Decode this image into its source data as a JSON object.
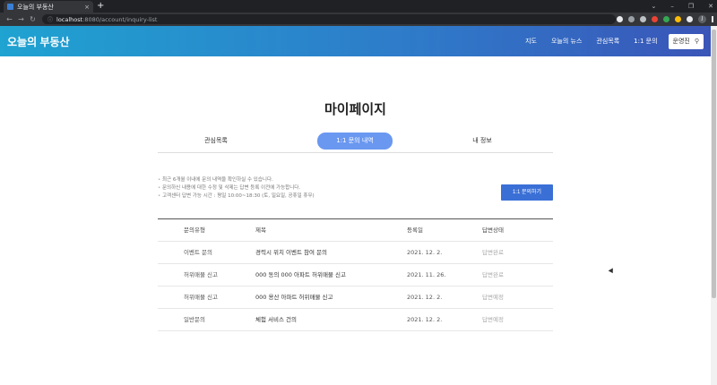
{
  "browser": {
    "tab_title": "오늘의 부동산",
    "tab_close": "×",
    "new_tab": "+",
    "url_host": "localhost",
    "url_path": ":8080/account/inquiry-list",
    "profile_initial": "J",
    "window_controls": [
      "⌄",
      "–",
      "❐",
      "✕"
    ]
  },
  "header": {
    "logo": "오늘의 부동산",
    "nav": [
      "지도",
      "오늘의 뉴스",
      "관심목록",
      "1:1 문의"
    ],
    "user_name": "운영진"
  },
  "page": {
    "title": "마이페이지",
    "tabs": [
      "관심목록",
      "1:1 문의 내역",
      "내 정보"
    ],
    "active_tab": "1:1 문의 내역"
  },
  "notice": [
    "최근 6개월 이내에 문의 내역을 확인하실 수 있습니다.",
    "문의하신 내용에 대한 수정 및 삭제는 답변 등록 이전에 가능합니다.",
    "고객센터 답변 가능 시간 : 평일 10:00~18:30 (토, 일요일, 공휴일 휴무)"
  ],
  "inquiry_button": "1:1 문의하기",
  "table": {
    "columns": [
      "문의유형",
      "제목",
      "등록일",
      "답변상태"
    ],
    "rows": [
      [
        "이벤트 문의",
        "경력시 위치 이벤트 참여 문의",
        "2021. 12. 2.",
        "답변완료"
      ],
      [
        "허위매물 신고",
        "000 동의 000 아파트 허위매물 신고",
        "2021. 11. 26.",
        "답변완료"
      ],
      [
        "허위매물 신고",
        "000 용산 아파트 허위매물 신고",
        "2021. 12. 2.",
        "답변예정"
      ],
      [
        "일반문의",
        "체험 서비스 건의",
        "2021. 12. 2.",
        "답변예정"
      ]
    ]
  },
  "colors": {
    "header_start": "#1fa3d1",
    "header_end": "#3a55b8",
    "active_tab": "#6a98f0",
    "primary_button": "#3a6fd6"
  }
}
